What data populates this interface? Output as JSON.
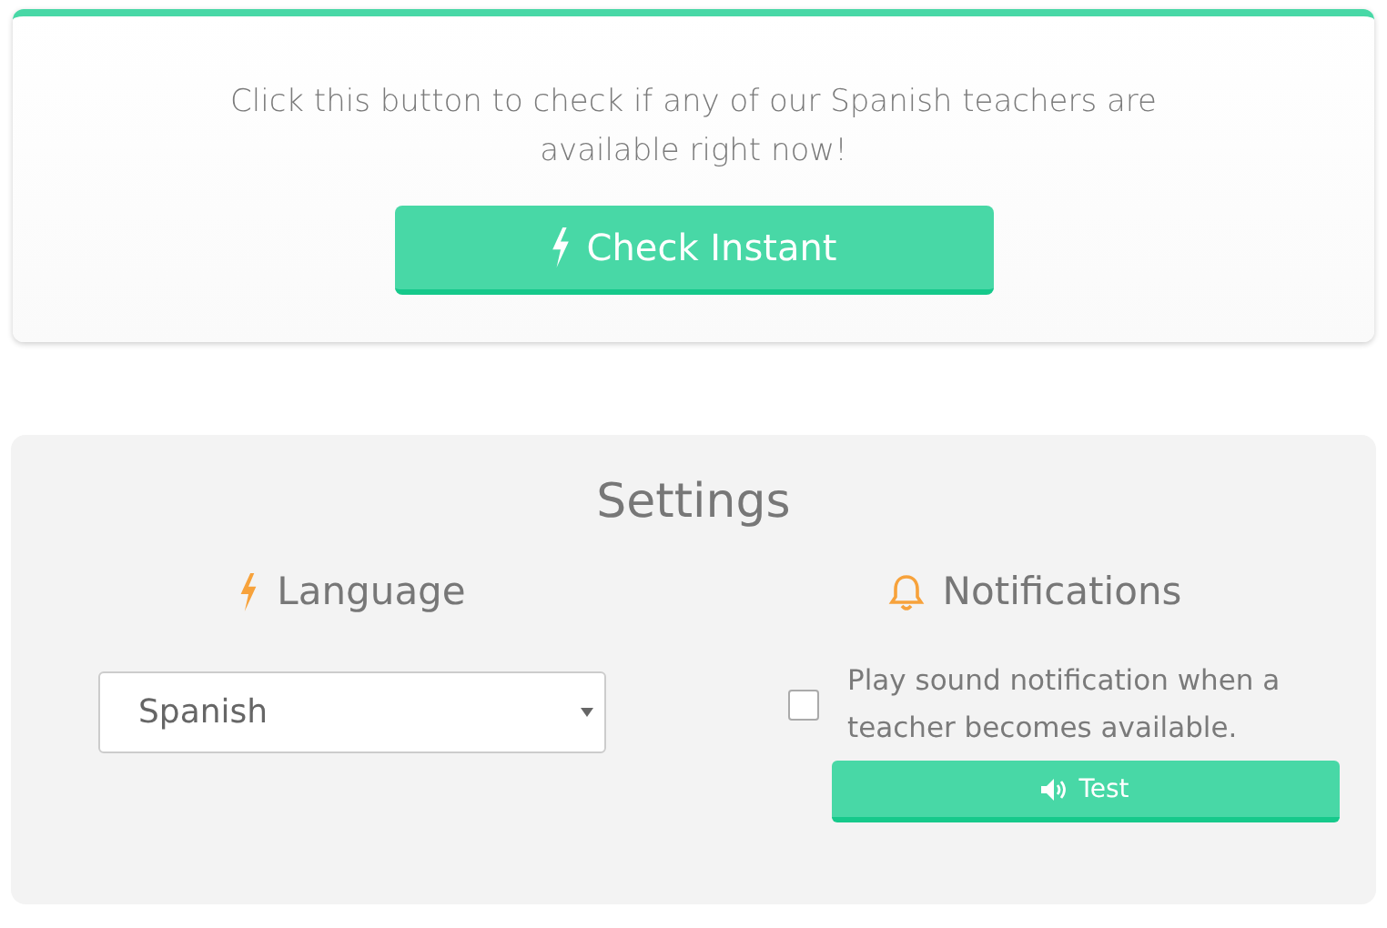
{
  "instant": {
    "message": "Click this button to check if any of our Spanish teachers are available right now!",
    "button": "Check Instant"
  },
  "settings": {
    "title": "Settings",
    "language": {
      "heading": "Language",
      "value": "Spanish"
    },
    "notifications": {
      "heading": "Notifications",
      "checked": false,
      "label": "Play sound notification when a teacher becomes available.",
      "test_button": "Test"
    }
  }
}
